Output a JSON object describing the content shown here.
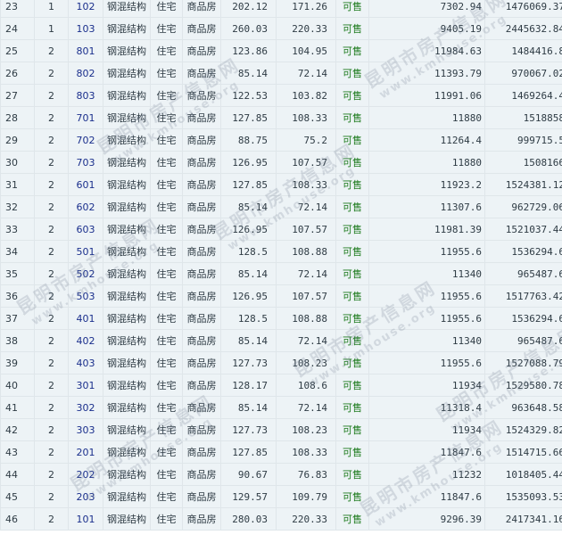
{
  "watermark": {
    "cn": "昆明市房产信息网",
    "en": "www.kmhouse.org"
  },
  "rows": [
    {
      "no": "23",
      "building": "1",
      "room": "102",
      "structure": "钢混结构",
      "use": "住宅",
      "type": "商品房",
      "area": "202.12",
      "inner_area": "171.26",
      "status": "可售",
      "unit_price": "7302.94",
      "total": "1476069.37"
    },
    {
      "no": "24",
      "building": "1",
      "room": "103",
      "structure": "钢混结构",
      "use": "住宅",
      "type": "商品房",
      "area": "260.03",
      "inner_area": "220.33",
      "status": "可售",
      "unit_price": "9405.19",
      "total": "2445632.84"
    },
    {
      "no": "25",
      "building": "2",
      "room": "801",
      "structure": "钢混结构",
      "use": "住宅",
      "type": "商品房",
      "area": "123.86",
      "inner_area": "104.95",
      "status": "可售",
      "unit_price": "11984.63",
      "total": "1484416.8"
    },
    {
      "no": "26",
      "building": "2",
      "room": "802",
      "structure": "钢混结构",
      "use": "住宅",
      "type": "商品房",
      "area": "85.14",
      "inner_area": "72.14",
      "status": "可售",
      "unit_price": "11393.79",
      "total": "970067.02"
    },
    {
      "no": "27",
      "building": "2",
      "room": "803",
      "structure": "钢混结构",
      "use": "住宅",
      "type": "商品房",
      "area": "122.53",
      "inner_area": "103.82",
      "status": "可售",
      "unit_price": "11991.06",
      "total": "1469264.4"
    },
    {
      "no": "28",
      "building": "2",
      "room": "701",
      "structure": "钢混结构",
      "use": "住宅",
      "type": "商品房",
      "area": "127.85",
      "inner_area": "108.33",
      "status": "可售",
      "unit_price": "11880",
      "total": "1518858"
    },
    {
      "no": "29",
      "building": "2",
      "room": "702",
      "structure": "钢混结构",
      "use": "住宅",
      "type": "商品房",
      "area": "88.75",
      "inner_area": "75.2",
      "status": "可售",
      "unit_price": "11264.4",
      "total": "999715.5"
    },
    {
      "no": "30",
      "building": "2",
      "room": "703",
      "structure": "钢混结构",
      "use": "住宅",
      "type": "商品房",
      "area": "126.95",
      "inner_area": "107.57",
      "status": "可售",
      "unit_price": "11880",
      "total": "1508166"
    },
    {
      "no": "31",
      "building": "2",
      "room": "601",
      "structure": "钢混结构",
      "use": "住宅",
      "type": "商品房",
      "area": "127.85",
      "inner_area": "108.33",
      "status": "可售",
      "unit_price": "11923.2",
      "total": "1524381.12"
    },
    {
      "no": "32",
      "building": "2",
      "room": "602",
      "structure": "钢混结构",
      "use": "住宅",
      "type": "商品房",
      "area": "85.14",
      "inner_area": "72.14",
      "status": "可售",
      "unit_price": "11307.6",
      "total": "962729.06"
    },
    {
      "no": "33",
      "building": "2",
      "room": "603",
      "structure": "钢混结构",
      "use": "住宅",
      "type": "商品房",
      "area": "126.95",
      "inner_area": "107.57",
      "status": "可售",
      "unit_price": "11981.39",
      "total": "1521037.44"
    },
    {
      "no": "34",
      "building": "2",
      "room": "501",
      "structure": "钢混结构",
      "use": "住宅",
      "type": "商品房",
      "area": "128.5",
      "inner_area": "108.88",
      "status": "可售",
      "unit_price": "11955.6",
      "total": "1536294.6"
    },
    {
      "no": "35",
      "building": "2",
      "room": "502",
      "structure": "钢混结构",
      "use": "住宅",
      "type": "商品房",
      "area": "85.14",
      "inner_area": "72.14",
      "status": "可售",
      "unit_price": "11340",
      "total": "965487.6"
    },
    {
      "no": "36",
      "building": "2",
      "room": "503",
      "structure": "钢混结构",
      "use": "住宅",
      "type": "商品房",
      "area": "126.95",
      "inner_area": "107.57",
      "status": "可售",
      "unit_price": "11955.6",
      "total": "1517763.42"
    },
    {
      "no": "37",
      "building": "2",
      "room": "401",
      "structure": "钢混结构",
      "use": "住宅",
      "type": "商品房",
      "area": "128.5",
      "inner_area": "108.88",
      "status": "可售",
      "unit_price": "11955.6",
      "total": "1536294.6"
    },
    {
      "no": "38",
      "building": "2",
      "room": "402",
      "structure": "钢混结构",
      "use": "住宅",
      "type": "商品房",
      "area": "85.14",
      "inner_area": "72.14",
      "status": "可售",
      "unit_price": "11340",
      "total": "965487.6"
    },
    {
      "no": "39",
      "building": "2",
      "room": "403",
      "structure": "钢混结构",
      "use": "住宅",
      "type": "商品房",
      "area": "127.73",
      "inner_area": "108.23",
      "status": "可售",
      "unit_price": "11955.6",
      "total": "1527088.79"
    },
    {
      "no": "40",
      "building": "2",
      "room": "301",
      "structure": "钢混结构",
      "use": "住宅",
      "type": "商品房",
      "area": "128.17",
      "inner_area": "108.6",
      "status": "可售",
      "unit_price": "11934",
      "total": "1529580.78"
    },
    {
      "no": "41",
      "building": "2",
      "room": "302",
      "structure": "钢混结构",
      "use": "住宅",
      "type": "商品房",
      "area": "85.14",
      "inner_area": "72.14",
      "status": "可售",
      "unit_price": "11318.4",
      "total": "963648.58"
    },
    {
      "no": "42",
      "building": "2",
      "room": "303",
      "structure": "钢混结构",
      "use": "住宅",
      "type": "商品房",
      "area": "127.73",
      "inner_area": "108.23",
      "status": "可售",
      "unit_price": "11934",
      "total": "1524329.82"
    },
    {
      "no": "43",
      "building": "2",
      "room": "201",
      "structure": "钢混结构",
      "use": "住宅",
      "type": "商品房",
      "area": "127.85",
      "inner_area": "108.33",
      "status": "可售",
      "unit_price": "11847.6",
      "total": "1514715.66"
    },
    {
      "no": "44",
      "building": "2",
      "room": "202",
      "structure": "钢混结构",
      "use": "住宅",
      "type": "商品房",
      "area": "90.67",
      "inner_area": "76.83",
      "status": "可售",
      "unit_price": "11232",
      "total": "1018405.44"
    },
    {
      "no": "45",
      "building": "2",
      "room": "203",
      "structure": "钢混结构",
      "use": "住宅",
      "type": "商品房",
      "area": "129.57",
      "inner_area": "109.79",
      "status": "可售",
      "unit_price": "11847.6",
      "total": "1535093.53"
    },
    {
      "no": "46",
      "building": "2",
      "room": "101",
      "structure": "钢混结构",
      "use": "住宅",
      "type": "商品房",
      "area": "280.03",
      "inner_area": "220.33",
      "status": "可售",
      "unit_price": "9296.39",
      "total": "2417341.16"
    }
  ]
}
